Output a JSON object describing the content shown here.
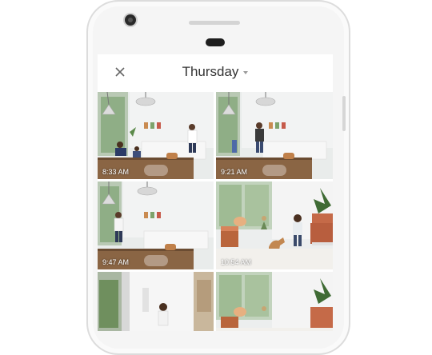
{
  "header": {
    "title": "Thursday"
  },
  "icons": {
    "close": "close-icon",
    "dropdown": "caret-down-icon"
  },
  "clips": [
    {
      "time": "8:33 AM"
    },
    {
      "time": "9:21 AM"
    },
    {
      "time": "9:47 AM"
    },
    {
      "time": "10:54 AM"
    },
    {
      "time": ""
    },
    {
      "time": ""
    }
  ]
}
